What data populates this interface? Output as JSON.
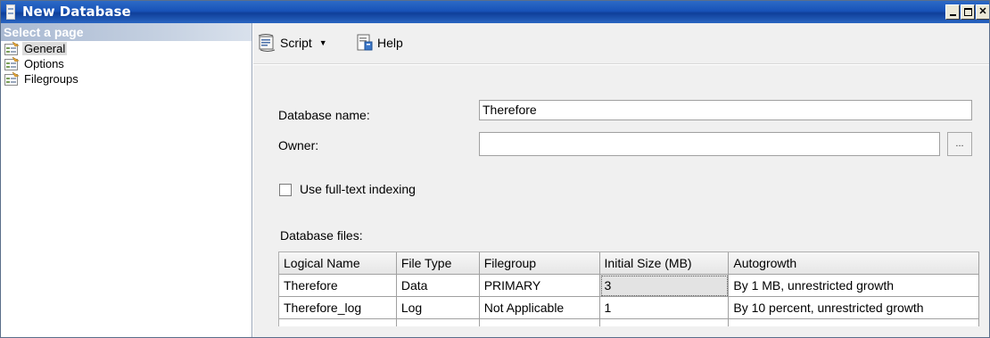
{
  "window": {
    "title": "New Database"
  },
  "sidebar": {
    "header": "Select a page",
    "items": [
      {
        "label": "General",
        "selected": true
      },
      {
        "label": "Options",
        "selected": false
      },
      {
        "label": "Filegroups",
        "selected": false
      }
    ]
  },
  "toolbar": {
    "script_label": "Script",
    "help_label": "Help"
  },
  "form": {
    "db_name_label": "Database name:",
    "db_name_value": "Therefore",
    "owner_label": "Owner:",
    "owner_value": "",
    "ellipsis_label": "...",
    "fulltext_label": "Use full-text indexing",
    "fulltext_checked": false,
    "files_label": "Database files:"
  },
  "grid": {
    "columns": [
      "Logical Name",
      "File Type",
      "Filegroup",
      "Initial Size (MB)",
      "Autogrowth"
    ],
    "rows": [
      [
        "Therefore",
        "Data",
        "PRIMARY",
        "3",
        "By 1 MB, unrestricted growth"
      ],
      [
        "Therefore_log",
        "Log",
        "Not Applicable",
        "1",
        "By 10 percent, unrestricted growth"
      ]
    ]
  },
  "icons": {
    "title": "document-icon",
    "page": "page-properties-icon",
    "script": "script-icon",
    "help": "help-icon"
  },
  "colors": {
    "titlebar": "#1853b8",
    "panel_header": "#a9b9d2",
    "background": "#f0f0f0"
  }
}
